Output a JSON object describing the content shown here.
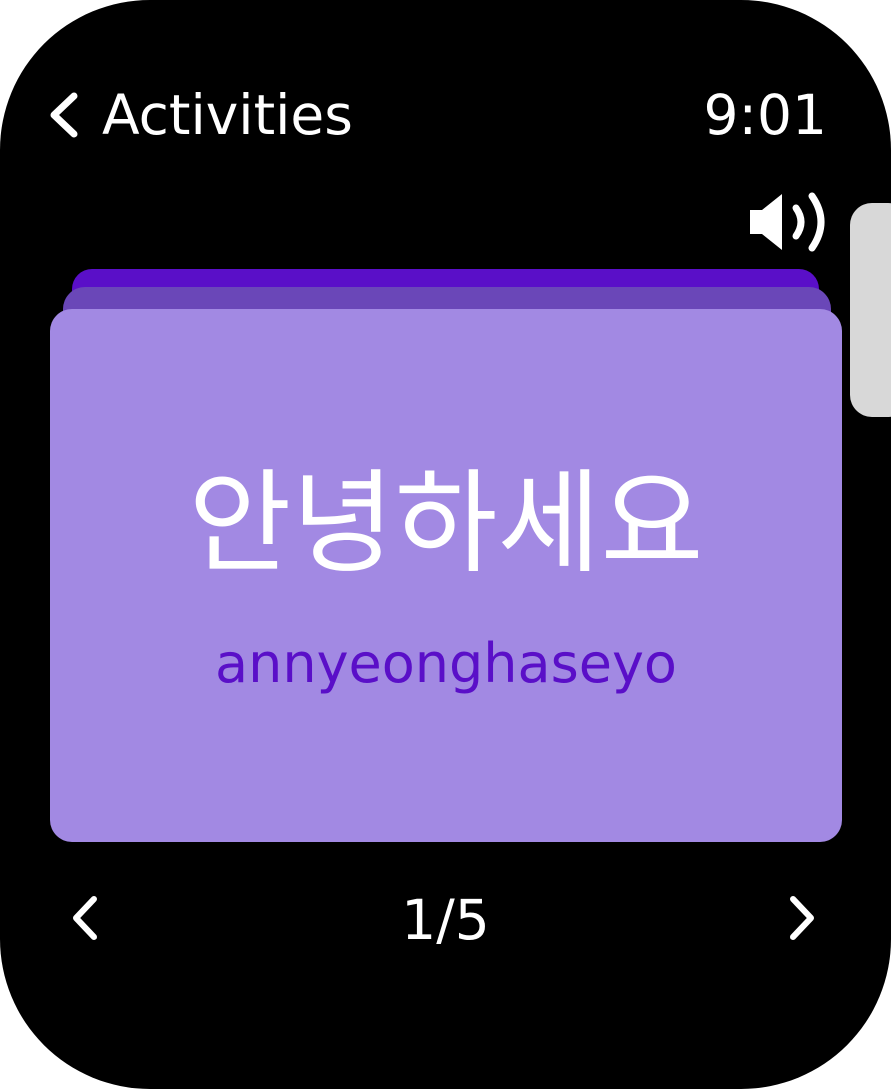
{
  "header": {
    "back_label": "Activities",
    "time": "9:01"
  },
  "card": {
    "word": "안녕하세요",
    "romanization": "annyeonghaseyo"
  },
  "pager": {
    "current": "1/5"
  },
  "icons": {
    "back": "chevron-left-icon",
    "speaker": "speaker-icon",
    "prev": "chevron-left-icon",
    "next": "chevron-right-icon"
  },
  "colors": {
    "background": "#000000",
    "card_front": "#a289e3",
    "card_back_1": "#6a47b8",
    "card_back_2": "#5a0fc8",
    "romanization_text": "#5a0fc8",
    "crown": "#d8d8d8"
  }
}
